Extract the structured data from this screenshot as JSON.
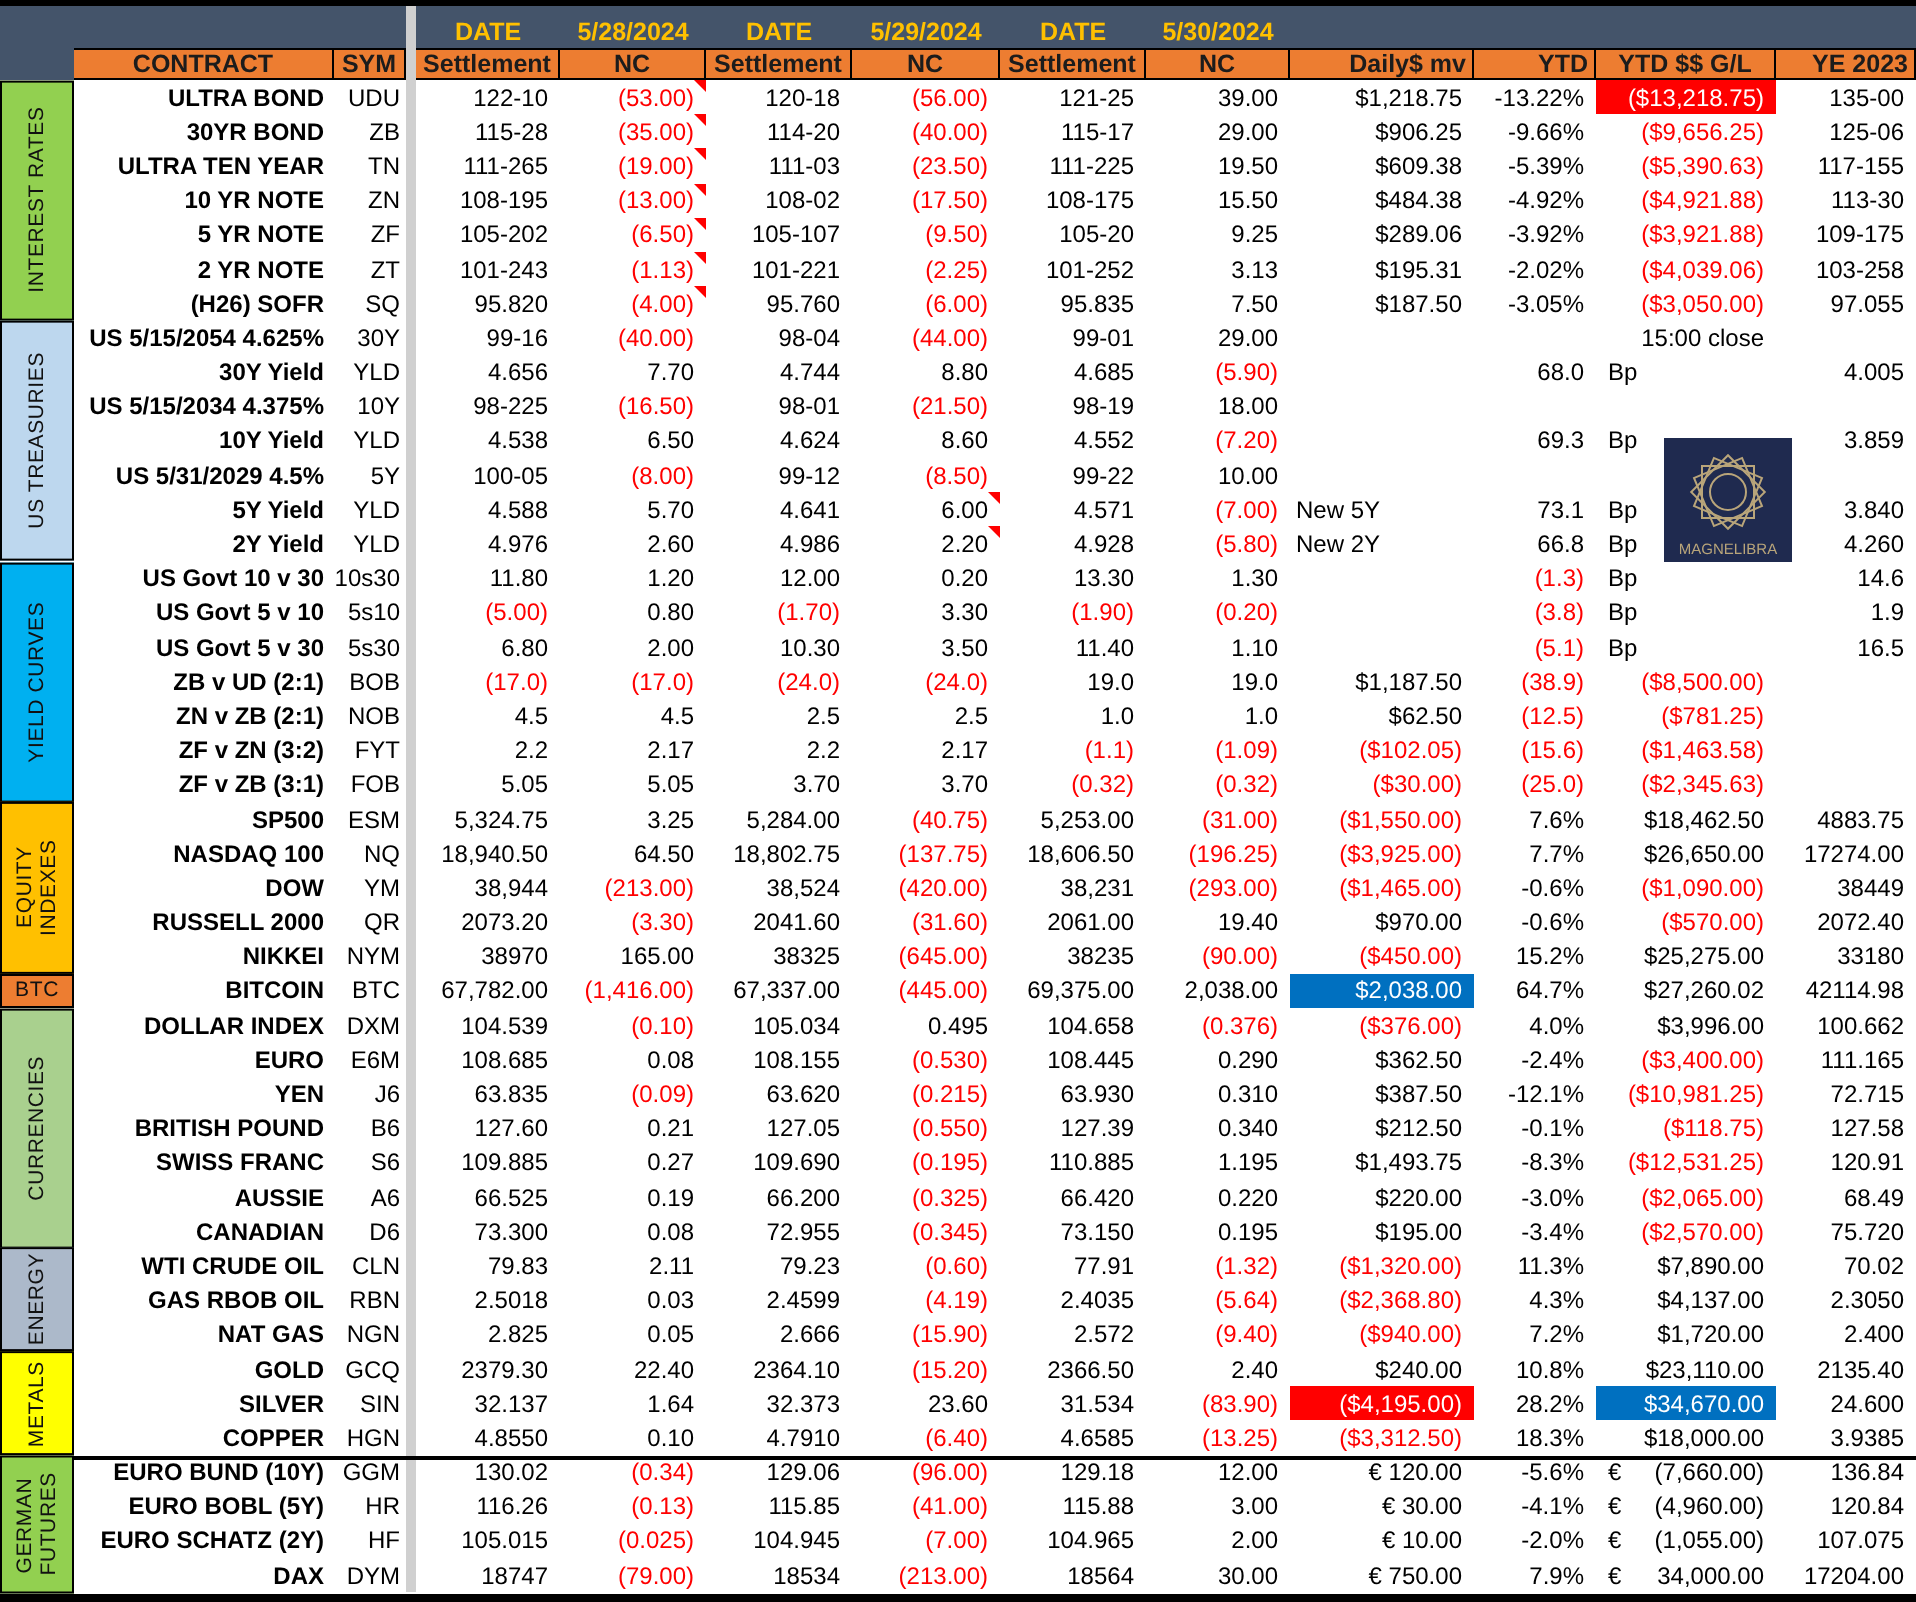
{
  "header": {
    "dates": [
      {
        "label": "DATE",
        "date": "5/28/2024"
      },
      {
        "label": "DATE",
        "date": "5/29/2024"
      },
      {
        "label": "DATE",
        "date": "5/30/2024"
      }
    ],
    "columns": [
      "CONTRACT",
      "SYM",
      "Settlement",
      "NC",
      "Settlement",
      "NC",
      "Settlement",
      "NC",
      "Daily$ mv",
      "YTD",
      "YTD $$ G/L",
      "YE 2023"
    ]
  },
  "groups": [
    {
      "label": "INTEREST RATES",
      "color": "#92d050",
      "rows": [
        {
          "contract": "ULTRA BOND",
          "sym": "UDU",
          "cells": [
            "122-10",
            {
              "text": "(53.00)",
              "negative": true,
              "comment": true
            },
            "120-18",
            {
              "text": "(56.00)",
              "negative": true
            },
            "121-25",
            "39.00",
            "$1,218.75",
            "-13.22%",
            {
              "text": "($13,218.75)",
              "color": "#ff0000"
            },
            "135-00"
          ]
        },
        {
          "contract": "30YR BOND",
          "sym": "ZB",
          "cells": [
            "115-28",
            {
              "text": "(35.00)",
              "negative": true,
              "comment": true
            },
            "114-20",
            {
              "text": "(40.00)",
              "negative": true
            },
            "115-17",
            "29.00",
            "$906.25",
            "-9.66%",
            {
              "text": "($9,656.25)",
              "negative": true
            },
            "125-06"
          ]
        },
        {
          "contract": "ULTRA TEN YEAR",
          "sym": "TN",
          "cells": [
            "111-265",
            {
              "text": "(19.00)",
              "negative": true,
              "comment": true
            },
            "111-03",
            {
              "text": "(23.50)",
              "negative": true
            },
            "111-225",
            "19.50",
            "$609.38",
            "-5.39%",
            {
              "text": "($5,390.63)",
              "negative": true
            },
            "117-155"
          ]
        },
        {
          "contract": "10 YR NOTE",
          "sym": "ZN",
          "cells": [
            "108-195",
            {
              "text": "(13.00)",
              "negative": true,
              "comment": true
            },
            "108-02",
            {
              "text": "(17.50)",
              "negative": true
            },
            "108-175",
            "15.50",
            "$484.38",
            "-4.92%",
            {
              "text": "($4,921.88)",
              "negative": true
            },
            "113-30"
          ]
        },
        {
          "contract": "5 YR NOTE",
          "sym": "ZF",
          "cells": [
            "105-202",
            {
              "text": "(6.50)",
              "negative": true,
              "comment": true
            },
            "105-107",
            {
              "text": "(9.50)",
              "negative": true
            },
            "105-20",
            "9.25",
            "$289.06",
            "-3.92%",
            {
              "text": "($3,921.88)",
              "negative": true
            },
            "109-175"
          ]
        },
        {
          "contract": "2 YR NOTE",
          "sym": "ZT",
          "cells": [
            "101-243",
            {
              "text": "(1.13)",
              "negative": true,
              "comment": true
            },
            "101-221",
            {
              "text": "(2.25)",
              "negative": true
            },
            "101-252",
            "3.13",
            "$195.31",
            "-2.02%",
            {
              "text": "($4,039.06)",
              "negative": true
            },
            "103-258"
          ]
        },
        {
          "contract": "(H26) SOFR",
          "sym": "SQ",
          "cells": [
            "95.820",
            {
              "text": "(4.00)",
              "negative": true,
              "comment": true
            },
            "95.760",
            {
              "text": "(6.00)",
              "negative": true
            },
            "95.835",
            "7.50",
            "$187.50",
            "-3.05%",
            {
              "text": "($3,050.00)",
              "negative": true
            },
            "97.055"
          ]
        }
      ]
    },
    {
      "label": "US TREASURIES",
      "color": "#bdd7ee",
      "rows": [
        {
          "contract": "US 5/15/2054 4.625%",
          "sym": "30Y",
          "cells": [
            "99-16",
            {
              "text": "(40.00)",
              "negative": true
            },
            "98-04",
            {
              "text": "(44.00)",
              "negative": true
            },
            "99-01",
            "29.00",
            null,
            null,
            "15:00 close",
            null
          ]
        },
        {
          "contract": "30Y Yield",
          "sym": "YLD",
          "cells": [
            "4.656",
            "7.70",
            "4.744",
            "8.80",
            "4.685",
            {
              "text": "(5.90)",
              "negative": true
            },
            null,
            "68.0",
            {
              "unit": "Bp"
            },
            "4.005"
          ]
        },
        {
          "contract": "US 5/15/2034 4.375%",
          "sym": "10Y",
          "cells": [
            "98-225",
            {
              "text": "(16.50)",
              "negative": true
            },
            "98-01",
            {
              "text": "(21.50)",
              "negative": true
            },
            "98-19",
            "18.00",
            null,
            null,
            null,
            null
          ]
        },
        {
          "contract": "10Y Yield",
          "sym": "YLD",
          "cells": [
            "4.538",
            "6.50",
            "4.624",
            "8.60",
            "4.552",
            {
              "text": "(7.20)",
              "negative": true
            },
            null,
            "69.3",
            {
              "unit": "Bp"
            },
            "3.859"
          ]
        },
        {
          "contract": "US 5/31/2029 4.5%",
          "sym": "5Y",
          "cells": [
            "100-05",
            {
              "text": "(8.00)",
              "negative": true
            },
            "99-12",
            {
              "text": "(8.50)",
              "negative": true
            },
            "99-22",
            "10.00",
            null,
            null,
            null,
            null
          ]
        },
        {
          "contract": "5Y Yield",
          "sym": "YLD",
          "cells": [
            "4.588",
            "5.70",
            "4.641",
            {
              "text": "6.00",
              "comment": true
            },
            "4.571",
            {
              "text": "(7.00)",
              "negative": true
            },
            {
              "text": "New 5Y",
              "kind": "note"
            },
            "73.1",
            {
              "unit": "Bp"
            },
            "3.840"
          ]
        },
        {
          "contract": "2Y Yield",
          "sym": "YLD",
          "cells": [
            "4.976",
            "2.60",
            "4.986",
            {
              "text": "2.20",
              "comment": true
            },
            "4.928",
            {
              "text": "(5.80)",
              "negative": true
            },
            {
              "text": "New 2Y",
              "kind": "note"
            },
            "66.8",
            {
              "unit": "Bp"
            },
            "4.260"
          ]
        }
      ]
    },
    {
      "label": "YIELD CURVES",
      "color": "#00b0f0",
      "rows": [
        {
          "contract": "US Govt 10 v 30",
          "sym": "10s30",
          "cells": [
            "11.80",
            "1.20",
            "12.00",
            "0.20",
            "13.30",
            "1.30",
            null,
            {
              "text": "(1.3)",
              "negative": true
            },
            {
              "unit": "Bp"
            },
            "14.6"
          ]
        },
        {
          "contract": "US Govt 5 v 10",
          "sym": "5s10",
          "cells": [
            {
              "text": "(5.00)",
              "negative": true
            },
            "0.80",
            {
              "text": "(1.70)",
              "negative": true
            },
            "3.30",
            {
              "text": "(1.90)",
              "negative": true
            },
            {
              "text": "(0.20)",
              "negative": true
            },
            null,
            {
              "text": "(3.8)",
              "negative": true
            },
            {
              "unit": "Bp"
            },
            "1.9"
          ]
        },
        {
          "contract": "US Govt 5 v 30",
          "sym": "5s30",
          "cells": [
            "6.80",
            "2.00",
            "10.30",
            "3.50",
            "11.40",
            "1.10",
            null,
            {
              "text": "(5.1)",
              "negative": true
            },
            {
              "unit": "Bp"
            },
            "16.5"
          ]
        },
        {
          "contract": "ZB v UD (2:1)",
          "sym": "BOB",
          "cells": [
            {
              "text": "(17.0)",
              "negative": true
            },
            {
              "text": "(17.0)",
              "negative": true
            },
            {
              "text": "(24.0)",
              "negative": true
            },
            {
              "text": "(24.0)",
              "negative": true
            },
            "19.0",
            "19.0",
            "$1,187.50",
            {
              "text": "(38.9)",
              "negative": true
            },
            {
              "text": "($8,500.00)",
              "negative": true
            },
            null
          ]
        },
        {
          "contract": "ZN v ZB (2:1)",
          "sym": "NOB",
          "cells": [
            "4.5",
            "4.5",
            "2.5",
            "2.5",
            "1.0",
            "1.0",
            "$62.50",
            {
              "text": "(12.5)",
              "negative": true
            },
            {
              "text": "($781.25)",
              "negative": true
            },
            null
          ]
        },
        {
          "contract": "ZF v ZN (3:2)",
          "sym": "FYT",
          "cells": [
            "2.2",
            "2.17",
            "2.2",
            "2.17",
            {
              "text": "(1.1)",
              "negative": true
            },
            {
              "text": "(1.09)",
              "negative": true
            },
            {
              "text": "($102.05)",
              "negative": true
            },
            {
              "text": "(15.6)",
              "negative": true
            },
            {
              "text": "($1,463.58)",
              "negative": true
            },
            null
          ]
        },
        {
          "contract": "ZF v ZB (3:1)",
          "sym": "FOB",
          "cells": [
            "5.05",
            "5.05",
            "3.70",
            "3.70",
            {
              "text": "(0.32)",
              "negative": true
            },
            {
              "text": "(0.32)",
              "negative": true
            },
            {
              "text": "($30.00)",
              "negative": true
            },
            {
              "text": "(25.0)",
              "negative": true
            },
            {
              "text": "($2,345.63)",
              "negative": true
            },
            null
          ]
        }
      ]
    },
    {
      "label": "EQUITY INDEXES",
      "color": "#ffc000",
      "rows": [
        {
          "contract": "SP500",
          "sym": "ESM",
          "cells": [
            "5,324.75",
            "3.25",
            "5,284.00",
            {
              "text": "(40.75)",
              "negative": true
            },
            "5,253.00",
            {
              "text": "(31.00)",
              "negative": true
            },
            {
              "text": "($1,550.00)",
              "negative": true
            },
            "7.6%",
            "$18,462.50",
            "4883.75"
          ]
        },
        {
          "contract": "NASDAQ 100",
          "sym": "NQ",
          "cells": [
            "18,940.50",
            "64.50",
            "18,802.75",
            {
              "text": "(137.75)",
              "negative": true
            },
            "18,606.50",
            {
              "text": "(196.25)",
              "negative": true
            },
            {
              "text": "($3,925.00)",
              "negative": true
            },
            "7.7%",
            "$26,650.00",
            "17274.00"
          ]
        },
        {
          "contract": "DOW",
          "sym": "YM",
          "cells": [
            "38,944",
            {
              "text": "(213.00)",
              "negative": true
            },
            "38,524",
            {
              "text": "(420.00)",
              "negative": true
            },
            "38,231",
            {
              "text": "(293.00)",
              "negative": true
            },
            {
              "text": "($1,465.00)",
              "negative": true
            },
            "-0.6%",
            {
              "text": "($1,090.00)",
              "negative": true
            },
            "38449"
          ]
        },
        {
          "contract": "RUSSELL 2000",
          "sym": "QR",
          "cells": [
            "2073.20",
            {
              "text": "(3.30)",
              "negative": true
            },
            "2041.60",
            {
              "text": "(31.60)",
              "negative": true
            },
            "2061.00",
            "19.40",
            "$970.00",
            "-0.6%",
            {
              "text": "($570.00)",
              "negative": true
            },
            "2072.40"
          ]
        },
        {
          "contract": "NIKKEI",
          "sym": "NYM",
          "cells": [
            "38970",
            "165.00",
            "38325",
            {
              "text": "(645.00)",
              "negative": true
            },
            "38235",
            {
              "text": "(90.00)",
              "negative": true
            },
            {
              "text": "($450.00)",
              "negative": true
            },
            "15.2%",
            "$25,275.00",
            "33180"
          ]
        }
      ]
    },
    {
      "label": "BTC",
      "color": "#ed7d31",
      "rows": [
        {
          "contract": "BITCOIN",
          "sym": "BTC",
          "cells": [
            "67,782.00",
            {
              "text": "(1,416.00)",
              "negative": true
            },
            "67,337.00",
            {
              "text": "(445.00)",
              "negative": true
            },
            "69,375.00",
            "2,038.00",
            {
              "text": "$2,038.00",
              "color": "#0070c0"
            },
            "64.7%",
            "$27,260.02",
            "42114.98"
          ]
        }
      ]
    },
    {
      "label": "CURRENCIES",
      "color": "#a9d08e",
      "rows": [
        {
          "contract": "DOLLAR INDEX",
          "sym": "DXM",
          "cells": [
            "104.539",
            {
              "text": "(0.10)",
              "negative": true
            },
            "105.034",
            "0.495",
            "104.658",
            {
              "text": "(0.376)",
              "negative": true
            },
            {
              "text": "($376.00)",
              "negative": true
            },
            "4.0%",
            "$3,996.00",
            "100.662"
          ]
        },
        {
          "contract": "EURO",
          "sym": "E6M",
          "cells": [
            "108.685",
            "0.08",
            "108.155",
            {
              "text": "(0.530)",
              "negative": true
            },
            "108.445",
            "0.290",
            "$362.50",
            "-2.4%",
            {
              "text": "($3,400.00)",
              "negative": true
            },
            "111.165"
          ]
        },
        {
          "contract": "YEN",
          "sym": "J6",
          "cells": [
            "63.835",
            {
              "text": "(0.09)",
              "negative": true
            },
            "63.620",
            {
              "text": "(0.215)",
              "negative": true
            },
            "63.930",
            "0.310",
            "$387.50",
            "-12.1%",
            {
              "text": "($10,981.25)",
              "negative": true
            },
            "72.715"
          ]
        },
        {
          "contract": "BRITISH POUND",
          "sym": "B6",
          "cells": [
            "127.60",
            "0.21",
            "127.05",
            {
              "text": "(0.550)",
              "negative": true
            },
            "127.39",
            "0.340",
            "$212.50",
            "-0.1%",
            {
              "text": "($118.75)",
              "negative": true
            },
            "127.58"
          ]
        },
        {
          "contract": "SWISS FRANC",
          "sym": "S6",
          "cells": [
            "109.885",
            "0.27",
            "109.690",
            {
              "text": "(0.195)",
              "negative": true
            },
            "110.885",
            "1.195",
            "$1,493.75",
            "-8.3%",
            {
              "text": "($12,531.25)",
              "negative": true
            },
            "120.91"
          ]
        },
        {
          "contract": "AUSSIE",
          "sym": "A6",
          "cells": [
            "66.525",
            "0.19",
            "66.200",
            {
              "text": "(0.325)",
              "negative": true
            },
            "66.420",
            "0.220",
            "$220.00",
            "-3.0%",
            {
              "text": "($2,065.00)",
              "negative": true
            },
            "68.49"
          ]
        },
        {
          "contract": "CANADIAN",
          "sym": "D6",
          "cells": [
            "73.300",
            "0.08",
            "72.955",
            {
              "text": "(0.345)",
              "negative": true
            },
            "73.150",
            "0.195",
            "$195.00",
            "-3.4%",
            {
              "text": "($2,570.00)",
              "negative": true
            },
            "75.720"
          ]
        }
      ]
    },
    {
      "label": "ENERGY",
      "color": "#acb9ca",
      "rows": [
        {
          "contract": "WTI CRUDE OIL",
          "sym": "CLN",
          "cells": [
            "79.83",
            "2.11",
            "79.23",
            {
              "text": "(0.60)",
              "negative": true
            },
            "77.91",
            {
              "text": "(1.32)",
              "negative": true
            },
            {
              "text": "($1,320.00)",
              "negative": true
            },
            "11.3%",
            "$7,890.00",
            "70.02"
          ]
        },
        {
          "contract": "GAS RBOB OIL",
          "sym": "RBN",
          "cells": [
            "2.5018",
            "0.03",
            "2.4599",
            {
              "text": "(4.19)",
              "negative": true
            },
            "2.4035",
            {
              "text": "(5.64)",
              "negative": true
            },
            {
              "text": "($2,368.80)",
              "negative": true
            },
            "4.3%",
            "$4,137.00",
            "2.3050"
          ]
        },
        {
          "contract": "NAT GAS",
          "sym": "NGN",
          "cells": [
            "2.825",
            "0.05",
            "2.666",
            {
              "text": "(15.90)",
              "negative": true
            },
            "2.572",
            {
              "text": "(9.40)",
              "negative": true
            },
            {
              "text": "($940.00)",
              "negative": true
            },
            "7.2%",
            "$1,720.00",
            "2.400"
          ]
        }
      ]
    },
    {
      "label": "METALS",
      "color": "#ffff00",
      "rows": [
        {
          "contract": "GOLD",
          "sym": "GCQ",
          "cells": [
            "2379.30",
            "22.40",
            "2364.10",
            {
              "text": "(15.20)",
              "negative": true
            },
            "2366.50",
            "2.40",
            "$240.00",
            "10.8%",
            "$23,110.00",
            "2135.40"
          ]
        },
        {
          "contract": "SILVER",
          "sym": "SIN",
          "cells": [
            "32.137",
            "1.64",
            "32.373",
            "23.60",
            "31.534",
            {
              "text": "(83.90)",
              "negative": true
            },
            {
              "text": "($4,195.00)",
              "color": "#ff0000"
            },
            "28.2%",
            {
              "text": "$34,670.00",
              "color": "#0070c0"
            },
            "24.600"
          ]
        },
        {
          "contract": "COPPER",
          "sym": "HGN",
          "cells": [
            "4.8550",
            "0.10",
            "4.7910",
            {
              "text": "(6.40)",
              "negative": true
            },
            "4.6585",
            {
              "text": "(13.25)",
              "negative": true
            },
            {
              "text": "($3,312.50)",
              "negative": true
            },
            "18.3%",
            "$18,000.00",
            "3.9385"
          ]
        }
      ]
    },
    {
      "label": "GERMAN FUTURES",
      "color": "#92d050",
      "rule_above": true,
      "rows": [
        {
          "contract": "EURO BUND (10Y)",
          "sym": "GGM",
          "cells": [
            "130.02",
            {
              "text": "(0.34)",
              "negative": true
            },
            "129.06",
            {
              "text": "(96.00)",
              "negative": true
            },
            "129.18",
            "12.00",
            "€ 120.00",
            "-5.6%",
            {
              "unit": "€",
              "text": "(7,660.00)"
            },
            "136.84"
          ]
        },
        {
          "contract": "EURO BOBL (5Y)",
          "sym": "HR",
          "cells": [
            "116.26",
            {
              "text": "(0.13)",
              "negative": true
            },
            "115.85",
            {
              "text": "(41.00)",
              "negative": true
            },
            "115.88",
            "3.00",
            "€ 30.00",
            "-4.1%",
            {
              "unit": "€",
              "text": "(4,960.00)"
            },
            "120.84"
          ]
        },
        {
          "contract": "EURO SCHATZ (2Y)",
          "sym": "HF",
          "cells": [
            "105.015",
            {
              "text": "(0.025)",
              "negative": true
            },
            "104.945",
            {
              "text": "(7.00)",
              "negative": true
            },
            "104.965",
            "2.00",
            "€ 10.00",
            "-2.0%",
            {
              "unit": "€",
              "text": "(1,055.00)"
            },
            "107.075"
          ]
        },
        {
          "contract": "DAX",
          "sym": "DYM",
          "cells": [
            "18747",
            {
              "text": "(79.00)",
              "negative": true
            },
            "18534",
            {
              "text": "(213.00)",
              "negative": true
            },
            "18564",
            "30.00",
            "€ 750.00",
            "7.9%",
            {
              "unit": "€",
              "text": "34,000.00"
            },
            "17204.00"
          ]
        }
      ]
    }
  ],
  "logo": {
    "text": "MAGNELIBRA"
  }
}
